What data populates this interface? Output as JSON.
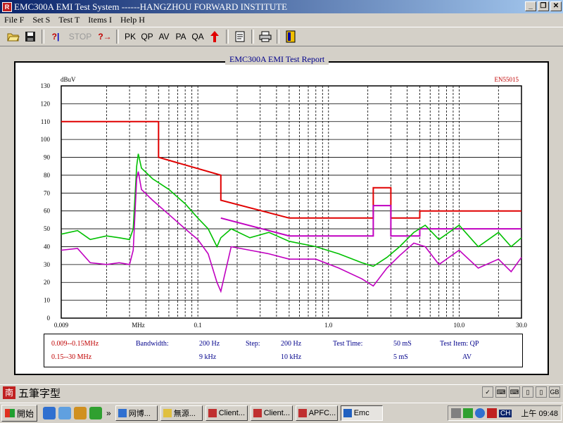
{
  "window": {
    "title": "EMC300A EMI Test System ------HANGZHOU FORWARD INSTITUTE",
    "app_icon_text": "R"
  },
  "menu": [
    "File F",
    "Set S",
    "Test T",
    "Items I",
    "Help H"
  ],
  "toolbar": {
    "open_icon": "folder-open-icon",
    "save_icon": "floppy-disk-icon",
    "help_label": "?",
    "stop_label": "STOP",
    "whatsthis_label": "?→",
    "pk_label": "PK",
    "qp_label": "QP",
    "av_label": "AV",
    "pa_label": "PA",
    "qa_label": "QA",
    "up_icon": "red-up-arrow-icon",
    "report_icon": "document-icon",
    "print_icon": "printer-icon",
    "exit_icon": "exit-door-icon"
  },
  "report": {
    "title": "EMC300A EMI Test Report",
    "standard": "EN55015"
  },
  "chart_data": {
    "type": "line",
    "title": "",
    "ylabel": "dBuV",
    "ylim": [
      0,
      130
    ],
    "yticks": [
      0,
      10,
      20,
      30,
      40,
      50,
      60,
      70,
      80,
      90,
      100,
      110,
      120,
      130
    ],
    "xlim": [
      0.009,
      30.0
    ],
    "xscale": "log",
    "xtick_labels": [
      {
        "value": 0.009,
        "label": "0.009"
      },
      {
        "value": 0.035,
        "label": "MHz"
      },
      {
        "value": 0.1,
        "label": "0.1"
      },
      {
        "value": 1.0,
        "label": "1.0"
      },
      {
        "value": 10.0,
        "label": "10.0"
      },
      {
        "value": 30.0,
        "label": "30.0"
      }
    ],
    "vgrid": [
      0.02,
      0.03,
      0.04,
      0.05,
      0.06,
      0.07,
      0.08,
      0.09,
      0.1,
      0.2,
      0.3,
      0.4,
      0.5,
      0.6,
      0.7,
      0.8,
      0.9,
      1,
      2,
      3,
      4,
      5,
      6,
      7,
      8,
      9,
      10,
      20
    ],
    "grid": true,
    "series": [
      {
        "color": "#e00000",
        "points": [
          [
            0.009,
            110
          ],
          [
            0.05,
            110
          ],
          [
            0.05,
            90
          ],
          [
            0.15,
            80
          ],
          [
            0.15,
            66
          ],
          [
            0.5,
            56
          ],
          [
            2.2,
            56
          ],
          [
            2.2,
            73
          ],
          [
            3,
            73
          ],
          [
            3,
            56
          ],
          [
            5,
            56
          ],
          [
            5,
            60
          ],
          [
            30,
            60
          ]
        ]
      },
      {
        "color": "#c000c0",
        "points": [
          [
            0.15,
            56
          ],
          [
            0.5,
            46
          ],
          [
            2.2,
            46
          ],
          [
            2.2,
            63
          ],
          [
            3,
            63
          ],
          [
            3,
            46
          ],
          [
            5,
            46
          ],
          [
            5,
            50
          ],
          [
            30,
            50
          ]
        ]
      },
      {
        "color": "#00c000",
        "points": [
          [
            0.009,
            47
          ],
          [
            0.012,
            49
          ],
          [
            0.015,
            44
          ],
          [
            0.02,
            46
          ],
          [
            0.025,
            45
          ],
          [
            0.03,
            44
          ],
          [
            0.032,
            50
          ],
          [
            0.034,
            85
          ],
          [
            0.035,
            92
          ],
          [
            0.037,
            84
          ],
          [
            0.045,
            78
          ],
          [
            0.06,
            72
          ],
          [
            0.08,
            64
          ],
          [
            0.1,
            56
          ],
          [
            0.12,
            50
          ],
          [
            0.14,
            40
          ],
          [
            0.15,
            45
          ],
          [
            0.18,
            50
          ],
          [
            0.25,
            45
          ],
          [
            0.35,
            48
          ],
          [
            0.5,
            43
          ],
          [
            0.8,
            40
          ],
          [
            1.2,
            36
          ],
          [
            1.8,
            31
          ],
          [
            2.2,
            29
          ],
          [
            2.8,
            34
          ],
          [
            3.5,
            40
          ],
          [
            4.5,
            48
          ],
          [
            5.5,
            52
          ],
          [
            7,
            44
          ],
          [
            10,
            52
          ],
          [
            14,
            40
          ],
          [
            20,
            48
          ],
          [
            25,
            40
          ],
          [
            30,
            45
          ]
        ]
      },
      {
        "color": "#c000c0",
        "points": [
          [
            0.009,
            38
          ],
          [
            0.012,
            39
          ],
          [
            0.015,
            31
          ],
          [
            0.02,
            30
          ],
          [
            0.025,
            31
          ],
          [
            0.03,
            30
          ],
          [
            0.032,
            38
          ],
          [
            0.034,
            78
          ],
          [
            0.035,
            82
          ],
          [
            0.037,
            72
          ],
          [
            0.045,
            66
          ],
          [
            0.06,
            58
          ],
          [
            0.08,
            50
          ],
          [
            0.1,
            44
          ],
          [
            0.12,
            36
          ],
          [
            0.14,
            20
          ],
          [
            0.15,
            15
          ],
          [
            0.18,
            40
          ],
          [
            0.25,
            38
          ],
          [
            0.35,
            36
          ],
          [
            0.5,
            33
          ],
          [
            0.8,
            33
          ],
          [
            1.2,
            28
          ],
          [
            1.8,
            22
          ],
          [
            2.2,
            18
          ],
          [
            2.8,
            28
          ],
          [
            3.5,
            35
          ],
          [
            4.5,
            42
          ],
          [
            5.5,
            40
          ],
          [
            7,
            30
          ],
          [
            10,
            38
          ],
          [
            14,
            28
          ],
          [
            20,
            33
          ],
          [
            25,
            26
          ],
          [
            30,
            34
          ]
        ]
      }
    ]
  },
  "info": {
    "range1": "0.009--0.15MHz",
    "range2": "0.15--30   MHz",
    "bandwidth_label": "Bandwidth:",
    "bw1": "200 Hz",
    "bw2": "9   kHz",
    "step_label": "Step:",
    "step1": "200 Hz",
    "step2": "10  kHz",
    "time_label": "Test Time:",
    "time1": "50  mS",
    "time2": "5   mS",
    "item_label": "Test Item: QP",
    "item2": "AV"
  },
  "ime": {
    "icon_text": "南",
    "text": "五筆字型"
  },
  "taskbar": {
    "start_label": "開始",
    "tasks": [
      "网博...",
      "無源...",
      "Client...",
      "Client...",
      "APFC...",
      "Emc"
    ],
    "clock": "上午 09:48",
    "lang": "CH"
  },
  "colors": {
    "limit_qp": "#e00000",
    "limit_av": "#c000c0",
    "trace_qp": "#00c000",
    "trace_av": "#c000c0",
    "report_title": "#00008b"
  }
}
